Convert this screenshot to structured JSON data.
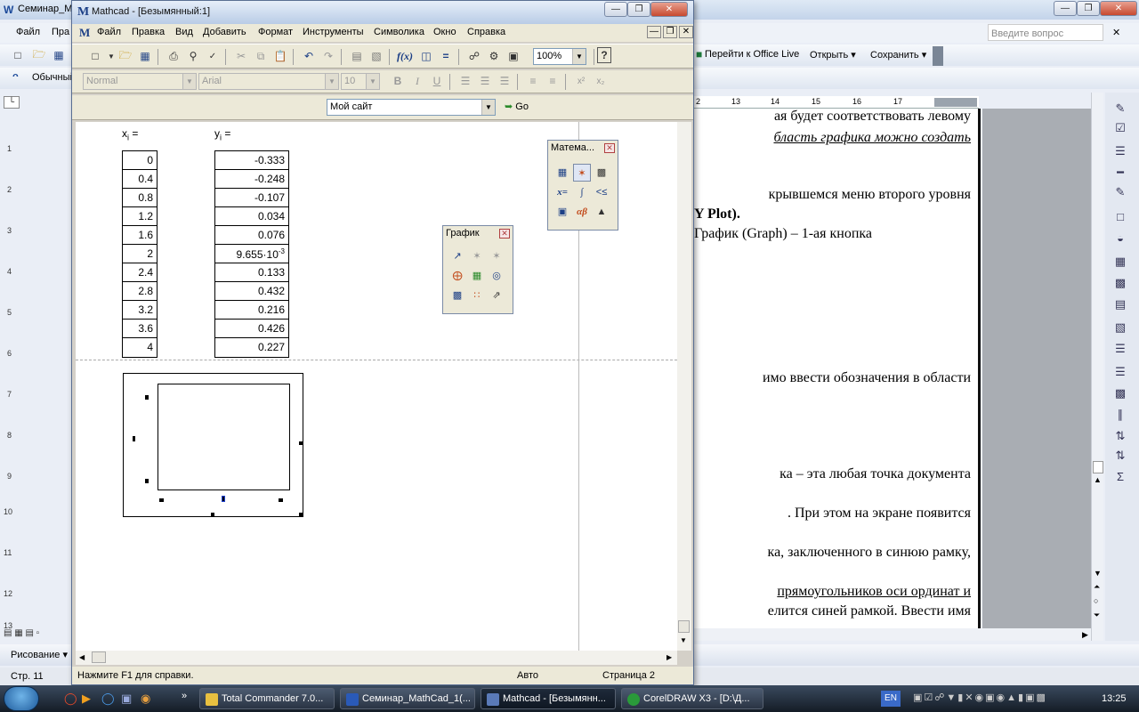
{
  "word": {
    "title": "Семинар_Ма",
    "menu": [
      "Файл",
      "Пра"
    ],
    "style_box": "Обычный",
    "search_placeholder": "Введите вопрос",
    "office_live": "Перейти к Office Live",
    "open": "Открыть",
    "save": "Сохранить",
    "ruler": [
      "2",
      "13",
      "14",
      "15",
      "16",
      "17"
    ],
    "vruler": [
      "1",
      "2",
      "3",
      "4",
      "5",
      "6",
      "7",
      "8",
      "9",
      "10",
      "11",
      "12",
      "13"
    ],
    "text_lines": [
      "ая будет соответствовать левому",
      "бласть графика можно создать",
      "крывшемся меню второго уровня",
      "Y Plot).",
      "График (Graph) – 1-ая кнопка",
      "имо ввести обозначения в области",
      "ка – эта любая точка документа",
      ". При этом на экране появится",
      "ка, заключенного в синюю рамку,",
      "прямоугольников оси ординат и",
      "елится синей рамкой. Ввести имя"
    ],
    "drawing_label": "Рисование",
    "status_page": "Стр. 11"
  },
  "mathcad": {
    "title": "Mathcad - [Безымянный:1]",
    "menu": [
      "Файл",
      "Правка",
      "Вид",
      "Добавить",
      "Формат",
      "Инструменты",
      "Символика",
      "Окно",
      "Справка"
    ],
    "zoom": "100%",
    "style": "Normal",
    "font": "Arial",
    "font_size": "10",
    "url_combo": "Мой сайт",
    "go": "Go",
    "x_label": "x",
    "x_sub": "i",
    "y_label": "y",
    "y_sub": "i",
    "eq": "=",
    "x_values": [
      "0",
      "0.4",
      "0.8",
      "1.2",
      "1.6",
      "2",
      "2.4",
      "2.8",
      "3.2",
      "3.6",
      "4"
    ],
    "y_values": [
      "-0.333",
      "-0.248",
      "-0.107",
      "0.034",
      "0.076",
      "9.655·10",
      "0.133",
      "0.432",
      "0.216",
      "0.426",
      "0.227"
    ],
    "y_exp": "-3",
    "palette_math_title": "Матема...",
    "palette_graph_title": "График",
    "status_help": "Нажмите F1 для справки.",
    "status_auto": "Авто",
    "status_page": "Страница 2"
  },
  "taskbar": {
    "tasks": [
      "Total Commander 7.0...",
      "Семинар_MathCad_1(...",
      "Mathcad - [Безымянн...",
      "CorelDRAW X3 - [D:\\Д..."
    ],
    "lang": "EN",
    "clock": "13:25"
  }
}
